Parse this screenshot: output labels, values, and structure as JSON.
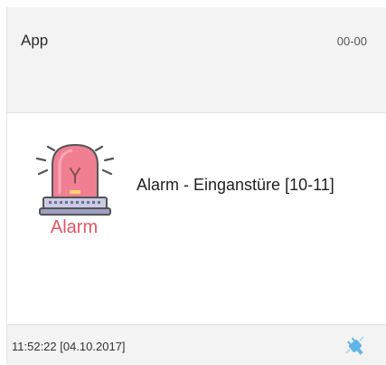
{
  "header": {
    "title": "App",
    "code": "00-00"
  },
  "alarm": {
    "icon_name": "alarm-siren-icon",
    "icon_label": "Alarm",
    "text": "Alarm - Einganstüre [10-11]",
    "color": "#e45563"
  },
  "footer": {
    "timestamp": "11:52:22 [04.10.2017]",
    "icon_name": "plug-icon",
    "icon_color": "#5fb4e6"
  }
}
